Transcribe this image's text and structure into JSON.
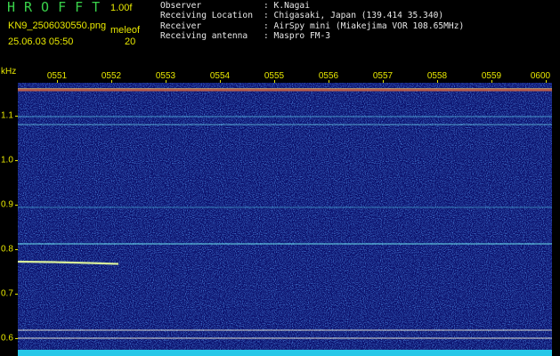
{
  "header": {
    "title": "HROFFT",
    "version": "1.00f",
    "filename": "KN9_2506030550.png",
    "meleof_label": "meleof",
    "datetime": "25.06.03 05:50",
    "count": "20"
  },
  "info": [
    {
      "label": "Observer",
      "value": ": K.Nagai"
    },
    {
      "label": "Receiving Location",
      "value": ": Chigasaki, Japan (139.414 35.340)"
    },
    {
      "label": "Receiver",
      "value": ": AirSpy mini (Miakejima VOR 108.65MHz)"
    },
    {
      "label": "Receiving antenna",
      "value": ": Maspro FM-3"
    }
  ],
  "axis": {
    "y_unit": "kHz",
    "y_ticks": [
      "1.1",
      "1.0",
      "0.9",
      "0.8",
      "0.7",
      "0.6"
    ],
    "time_ticks": [
      "0551",
      "0552",
      "0553",
      "0554",
      "0555",
      "0556",
      "0557",
      "0558",
      "0559",
      "0600"
    ]
  },
  "colors": {
    "background": "#000000",
    "plot_bg": "#0a0e6a",
    "header_title": "#39d24a",
    "label_yellow": "#e8e800",
    "info_text": "#e8e8e8",
    "carrier_line": "#b85a4a",
    "meteor_trail": "#d8ee9a"
  }
}
